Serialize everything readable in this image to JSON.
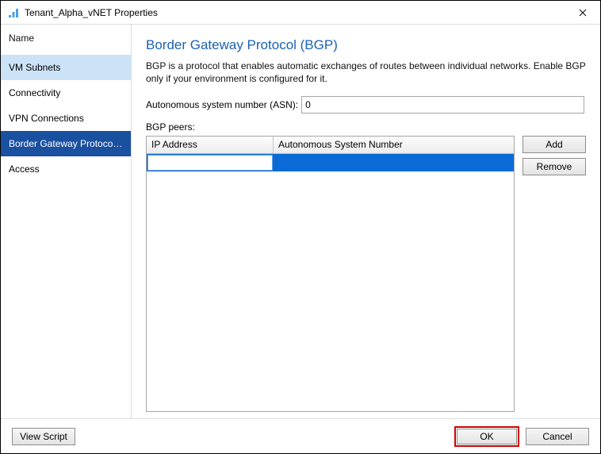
{
  "window": {
    "title": "Tenant_Alpha_vNET Properties"
  },
  "sidebar": {
    "header": "Name",
    "items": [
      {
        "label": "VM Subnets"
      },
      {
        "label": "Connectivity"
      },
      {
        "label": "VPN Connections"
      },
      {
        "label": "Border Gateway Protocol..."
      },
      {
        "label": "Access"
      }
    ]
  },
  "main": {
    "title": "Border Gateway Protocol (BGP)",
    "description": "BGP is a protocol that enables automatic exchanges of routes between individual networks. Enable BGP only if your environment is configured for it.",
    "asn_label": "Autonomous system number (ASN):",
    "asn_value": "0",
    "peers_label": "BGP peers:",
    "columns": {
      "ip": "IP Address",
      "asn": "Autonomous System Number"
    },
    "rows": [
      {
        "ip": "",
        "asn": ""
      }
    ],
    "buttons": {
      "add": "Add",
      "remove": "Remove"
    }
  },
  "footer": {
    "view_script": "View Script",
    "ok": "OK",
    "cancel": "Cancel"
  }
}
